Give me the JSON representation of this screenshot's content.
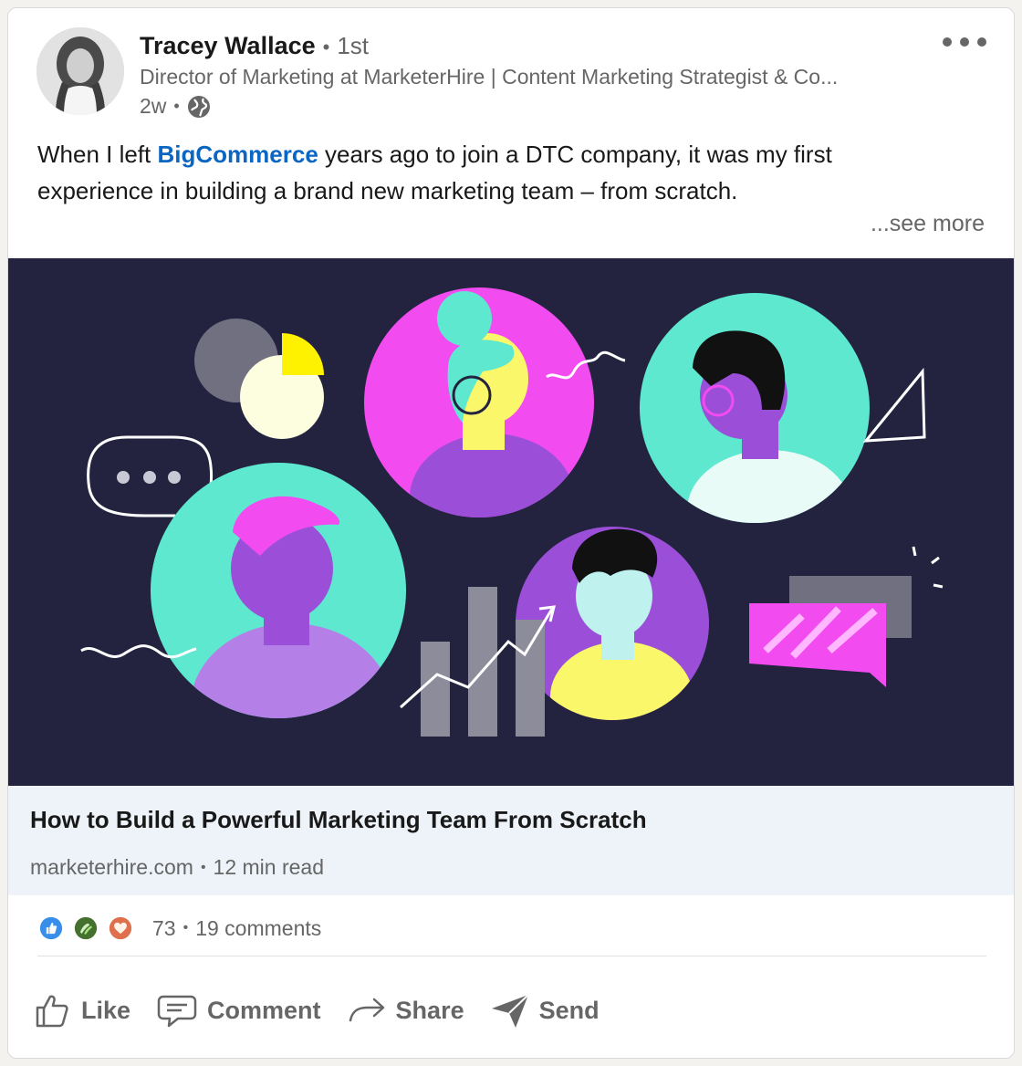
{
  "post": {
    "author": {
      "name": "Tracey Wallace",
      "degree": "1st",
      "headline": "Director of Marketing at MarketerHire | Content Marketing Strategist & Co...",
      "time": "2w",
      "separator": "•"
    },
    "text": {
      "part1": "When I left ",
      "mention": "BigCommerce",
      "part2": " years ago to join a DTC company, it was my first experience in building a brand new marketing team – from scratch."
    },
    "see_more": "...see more"
  },
  "article": {
    "title": "How to Build a Powerful Marketing Team From Scratch",
    "domain": "marketerhire.com",
    "read_time": "12 min read"
  },
  "social": {
    "reaction_icons": [
      "like-icon",
      "celebrate-icon",
      "love-icon"
    ],
    "reactions_count": "73",
    "comments": "19 comments"
  },
  "actions": {
    "like": "Like",
    "comment": "Comment",
    "share": "Share",
    "send": "Send"
  },
  "colors": {
    "link": "#0a66c2",
    "hero_bg": "#23233f",
    "teal": "#5ee8cf",
    "magenta": "#f24cf0",
    "purple": "#9b4fd9",
    "yellow": "#fbf76a"
  }
}
